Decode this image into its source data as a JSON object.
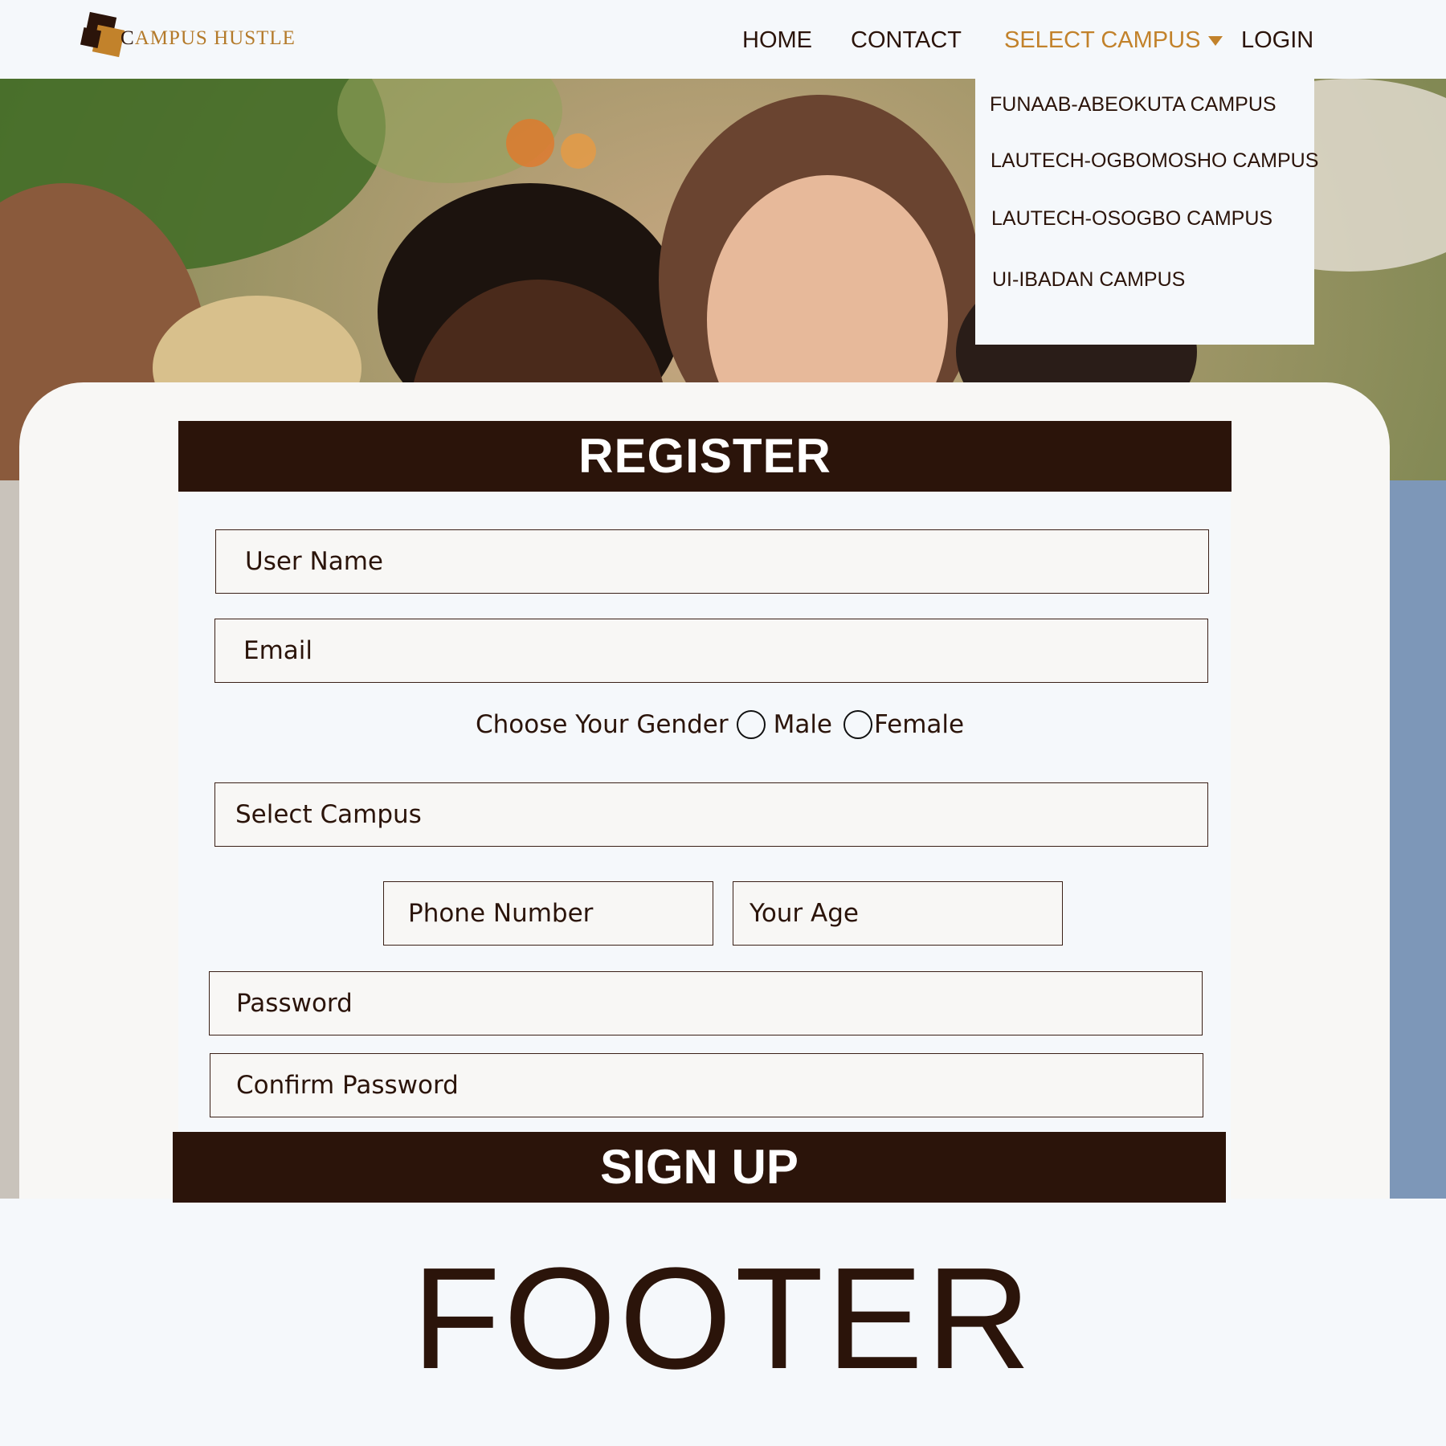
{
  "brand": {
    "logo_text": "AMPUS HUSTLE",
    "logo_letter": "C",
    "accent_color": "#c2822b",
    "dark_color": "#2b140a"
  },
  "nav": {
    "home": "HOME",
    "contact": "CONTACT",
    "select_campus": "SELECT CAMPUS",
    "login": "LOGIN",
    "dropdown_items": [
      "FUNAAB-ABEOKUTA CAMPUS",
      "LAUTECH-OGBOMOSHO CAMPUS",
      "LAUTECH-OSOGBO CAMPUS",
      "UI-IBADAN CAMPUS"
    ]
  },
  "form": {
    "title": "REGISTER",
    "username_placeholder": "User Name",
    "email_placeholder": "Email",
    "gender_label": "Choose Your Gender",
    "gender_male": "Male",
    "gender_female": "Female",
    "campus_placeholder": "Select Campus",
    "phone_placeholder": "Phone Number",
    "age_placeholder": "Your Age",
    "password_placeholder": "Password",
    "confirm_password_placeholder": "Confirm Password",
    "submit_label": "SIGN UP"
  },
  "footer": {
    "text": "FOOTER"
  }
}
